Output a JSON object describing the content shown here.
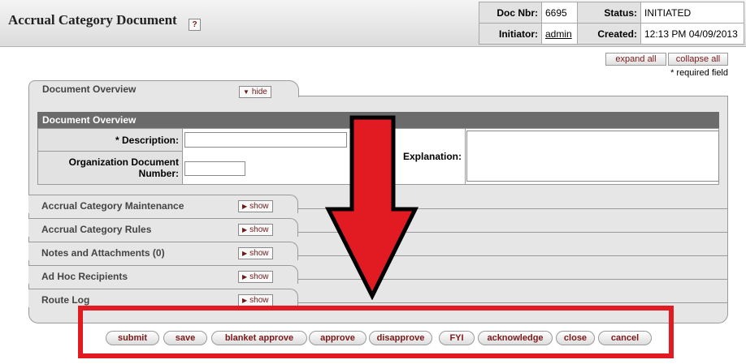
{
  "header": {
    "title": "Accrual Category Document",
    "help_icon": "question-icon",
    "doc_nbr_label": "Doc Nbr:",
    "doc_nbr": "6695",
    "status_label": "Status:",
    "status": "INITIATED",
    "initiator_label": "Initiator:",
    "initiator": "admin",
    "created_label": "Created:",
    "created": "12:13 PM 04/09/2013"
  },
  "controls": {
    "expand_all": "expand all",
    "collapse_all": "collapse all",
    "required_note": "* required field"
  },
  "overview": {
    "tab_label": "Document Overview",
    "hide_label": "hide",
    "section_title": "Document Overview",
    "description_label": "*  Description:",
    "description_value": "",
    "org_doc_label_1": "Organization Document",
    "org_doc_label_2": "Number:",
    "org_doc_value": "",
    "explanation_label": "Explanation:",
    "explanation_value": ""
  },
  "sections": [
    {
      "label": "Accrual Category Maintenance",
      "button": "show"
    },
    {
      "label": "Accrual Category Rules",
      "button": "show"
    },
    {
      "label": "Notes and Attachments (0)",
      "button": "show"
    },
    {
      "label": "Ad Hoc Recipients",
      "button": "show"
    },
    {
      "label": "Route Log",
      "button": "show"
    }
  ],
  "actions": [
    "submit",
    "save",
    "blanket approve",
    "approve",
    "disapprove",
    "FYI",
    "acknowledge",
    "close",
    "cancel"
  ],
  "annotation": {
    "arrow_icon": "down-arrow-icon",
    "box_color": "#e21b23",
    "arrow_color": "#e21b23"
  }
}
